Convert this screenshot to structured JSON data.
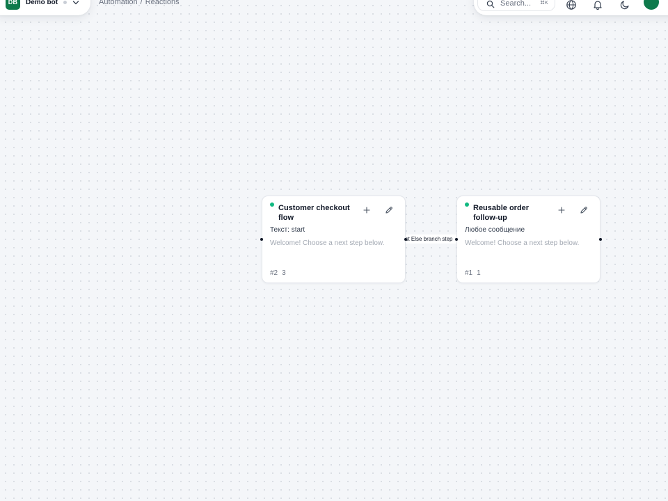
{
  "workspace": {
    "avatar_initials": "DB",
    "name": "Demo bot"
  },
  "breadcrumb": {
    "section": "Automation",
    "separator": "/",
    "page": "Reactions"
  },
  "toolbar": {
    "search_placeholder": "Search...",
    "search_shortcut": "⌘K",
    "icons": [
      "globe-icon",
      "bell-icon",
      "moon-icon"
    ],
    "avatar_color": "#0f7a4c"
  },
  "colors": {
    "brand": "#0f7a4c",
    "status_active": "#10b981"
  },
  "nodes": [
    {
      "title": "Customer checkout flow",
      "trigger": "Текст: start",
      "message": "Welcome! Choose a next step below.",
      "id_label": "#2",
      "count": "3"
    },
    {
      "title": "Reusable order follow-up",
      "trigger": "Любое сообщение",
      "message": "Welcome! Choose a next step below.",
      "id_label": "#1",
      "count": "1"
    }
  ],
  "edge": {
    "label": "Test Else branch step"
  }
}
